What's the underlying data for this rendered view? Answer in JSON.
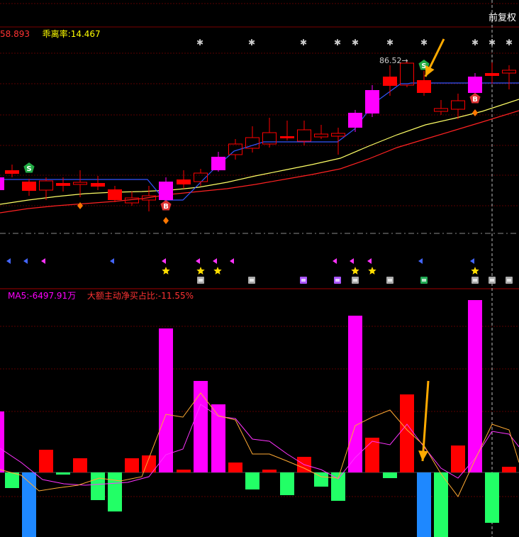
{
  "header": {
    "corner_label": "前复权"
  },
  "price_panel": {
    "legend": {
      "value_partial": "58.893",
      "value_color": "#ff3333",
      "deviation_label": "乖离率:",
      "deviation_value": "14.467",
      "deviation_color": "#ffff00"
    },
    "peak_label": "86.52→",
    "signal_buy": "B",
    "signal_sell": "S"
  },
  "flow_panel": {
    "ma5_label": "MA5:-6497.91万",
    "ma5_color": "#ff00ff",
    "ratio_label": "大额主动净买占比:-11.55%",
    "ratio_color": "#ff3333"
  },
  "colors": {
    "background": "#000000",
    "up_candle": "#ff0000",
    "down_candle": "#ff0000",
    "highlight_candle": "#ff00ff",
    "fast_line": "#ffff66",
    "slow_line": "#ff2222",
    "stop_line": "#3355ff",
    "bar_positive": "#ff0000",
    "bar_negative": "#22ff66",
    "bar_strong_positive": "#ff00ff",
    "bar_strong_negative": "#1e88ff",
    "arrow": "#ffaa00"
  },
  "icons": [
    "star-icon",
    "triangle-marker-icon",
    "diamond-icon",
    "badge-icon",
    "arrow-icon"
  ]
}
